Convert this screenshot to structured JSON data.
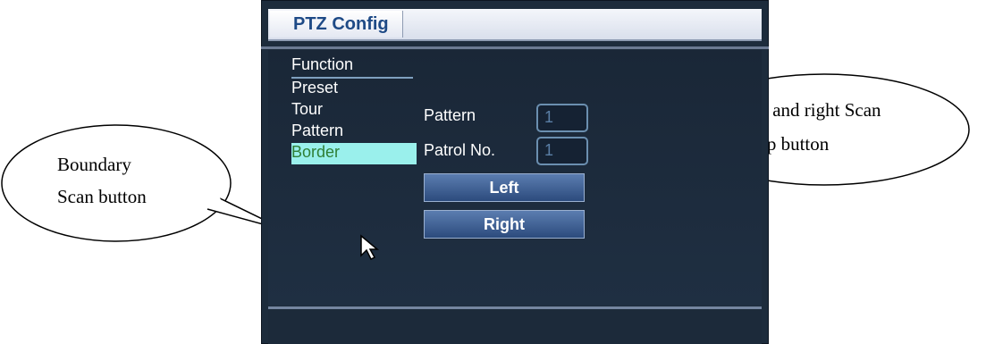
{
  "window": {
    "tab_title": "PTZ Config"
  },
  "menu": {
    "heading": "Function",
    "items": [
      "Preset",
      "Tour",
      "Pattern",
      "Border"
    ],
    "selected": "Border"
  },
  "fields": {
    "pattern_label": "Pattern",
    "pattern_value": "1",
    "patrol_label": "Patrol No.",
    "patrol_value": "1"
  },
  "buttons": {
    "left": "Left",
    "right": "Right"
  },
  "callouts": {
    "left_line1": "Boundary",
    "left_line2": "Scan button",
    "right_line1": "Left and right Scan",
    "right_line2": "setup button"
  },
  "colors": {
    "panel_bg": "#1d2c3c",
    "selected_item_bg": "#9af0ec",
    "selected_item_text": "#2f7f36",
    "button_bg": "#3a5a8f"
  }
}
